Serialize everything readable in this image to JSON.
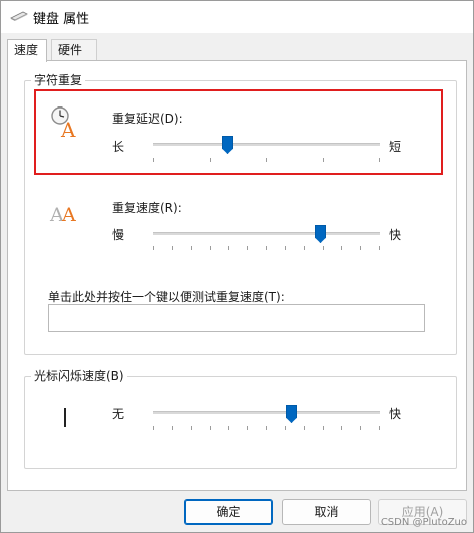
{
  "window": {
    "title": "键盘 属性",
    "icon": "keyboard-icon"
  },
  "tabs": [
    {
      "label": "速度",
      "active": true
    },
    {
      "label": "硬件",
      "active": false
    }
  ],
  "repeat_group": {
    "legend": "字符重复",
    "delay": {
      "label": "重复延迟(D):",
      "min_label": "长",
      "max_label": "短",
      "value_fraction": 0.33,
      "icon": "repeat-delay-icon"
    },
    "rate": {
      "label": "重复速度(R):",
      "min_label": "慢",
      "max_label": "快",
      "value_fraction": 0.74,
      "icon": "repeat-rate-icon"
    },
    "test": {
      "label": "单击此处并按住一个键以便测试重复速度(T):",
      "value": ""
    }
  },
  "cursor_group": {
    "legend": "光标闪烁速度(B)",
    "min_label": "无",
    "max_label": "快",
    "value_fraction": 0.61
  },
  "buttons": {
    "ok": "确定",
    "cancel": "取消",
    "apply": "应用(A)"
  },
  "watermark": "CSDN @PlutoZuo",
  "colors": {
    "accent": "#0067c0",
    "highlight": "#e01e1e",
    "icon_orange": "#e87722"
  }
}
